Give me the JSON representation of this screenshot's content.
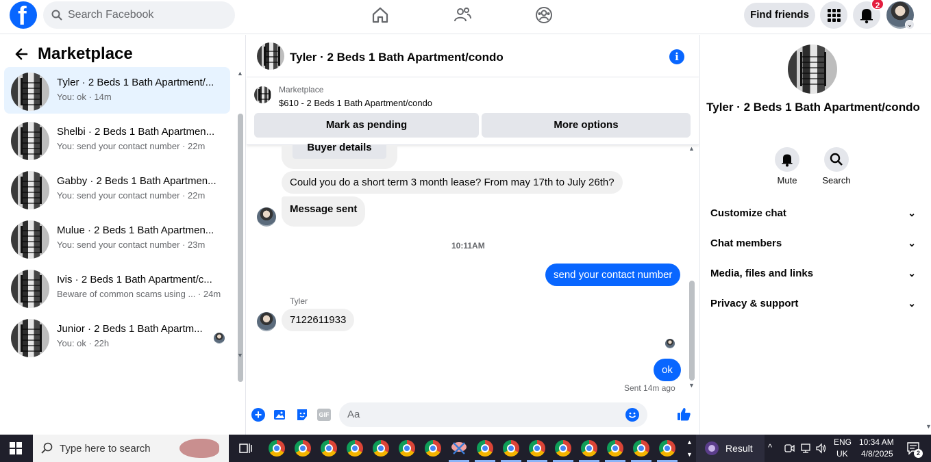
{
  "topbar": {
    "logo": "f",
    "search_placeholder": "Search Facebook",
    "find_friends": "Find friends",
    "notification_count": "2"
  },
  "left": {
    "title": "Marketplace",
    "conversations": [
      {
        "name": "Tyler · 2 Beds 1 Bath Apartment/...",
        "sub": "You: ok · 14m"
      },
      {
        "name": "Shelbi · 2 Beds 1 Bath Apartmen...",
        "sub": "You: send your contact number · 22m"
      },
      {
        "name": "Gabby · 2 Beds 1 Bath Apartmen...",
        "sub": "You: send your contact number · 22m"
      },
      {
        "name": "Mulue · 2 Beds 1 Bath Apartmen...",
        "sub": "You: send your contact number · 23m"
      },
      {
        "name": "Ivis · 2 Beds 1 Bath Apartment/c...",
        "sub": "Beware of common scams using ... · 24m"
      },
      {
        "name": "Junior · 2 Beds 1 Bath Apartm...",
        "sub": "You: ok · 22h"
      }
    ]
  },
  "chat": {
    "title": "Tyler · 2 Beds 1 Bath Apartment/condo",
    "listing_label": "Marketplace",
    "listing_price": "$610 - 2 Beds 1 Bath Apartment/condo",
    "mark_pending": "Mark as pending",
    "more_options": "More options",
    "buyer_details": "Buyer details",
    "msg_lease": "Could you do a short term 3 month lease? From may 17th to July 26th?",
    "msg_sent": "Message sent",
    "time_divider": "10:11AM",
    "msg_contact": "send your contact number",
    "sender_name": "Tyler",
    "msg_number": "7122611933",
    "msg_ok": "ok",
    "sent_status": "Sent 14m ago",
    "composer_placeholder": "Aa"
  },
  "right": {
    "title": "Tyler · 2 Beds 1 Bath Apartment/condo",
    "mute": "Mute",
    "search": "Search",
    "sections": [
      "Customize chat",
      "Chat members",
      "Media, files and links",
      "Privacy & support"
    ]
  },
  "taskbar": {
    "search_placeholder": "Type here to search",
    "result": "Result",
    "lang1": "ENG",
    "lang2": "UK",
    "time": "10:34 AM",
    "date": "4/8/2025",
    "notif": "2"
  },
  "colors": {
    "accent": "#0866ff",
    "badge": "#e41e3f"
  }
}
